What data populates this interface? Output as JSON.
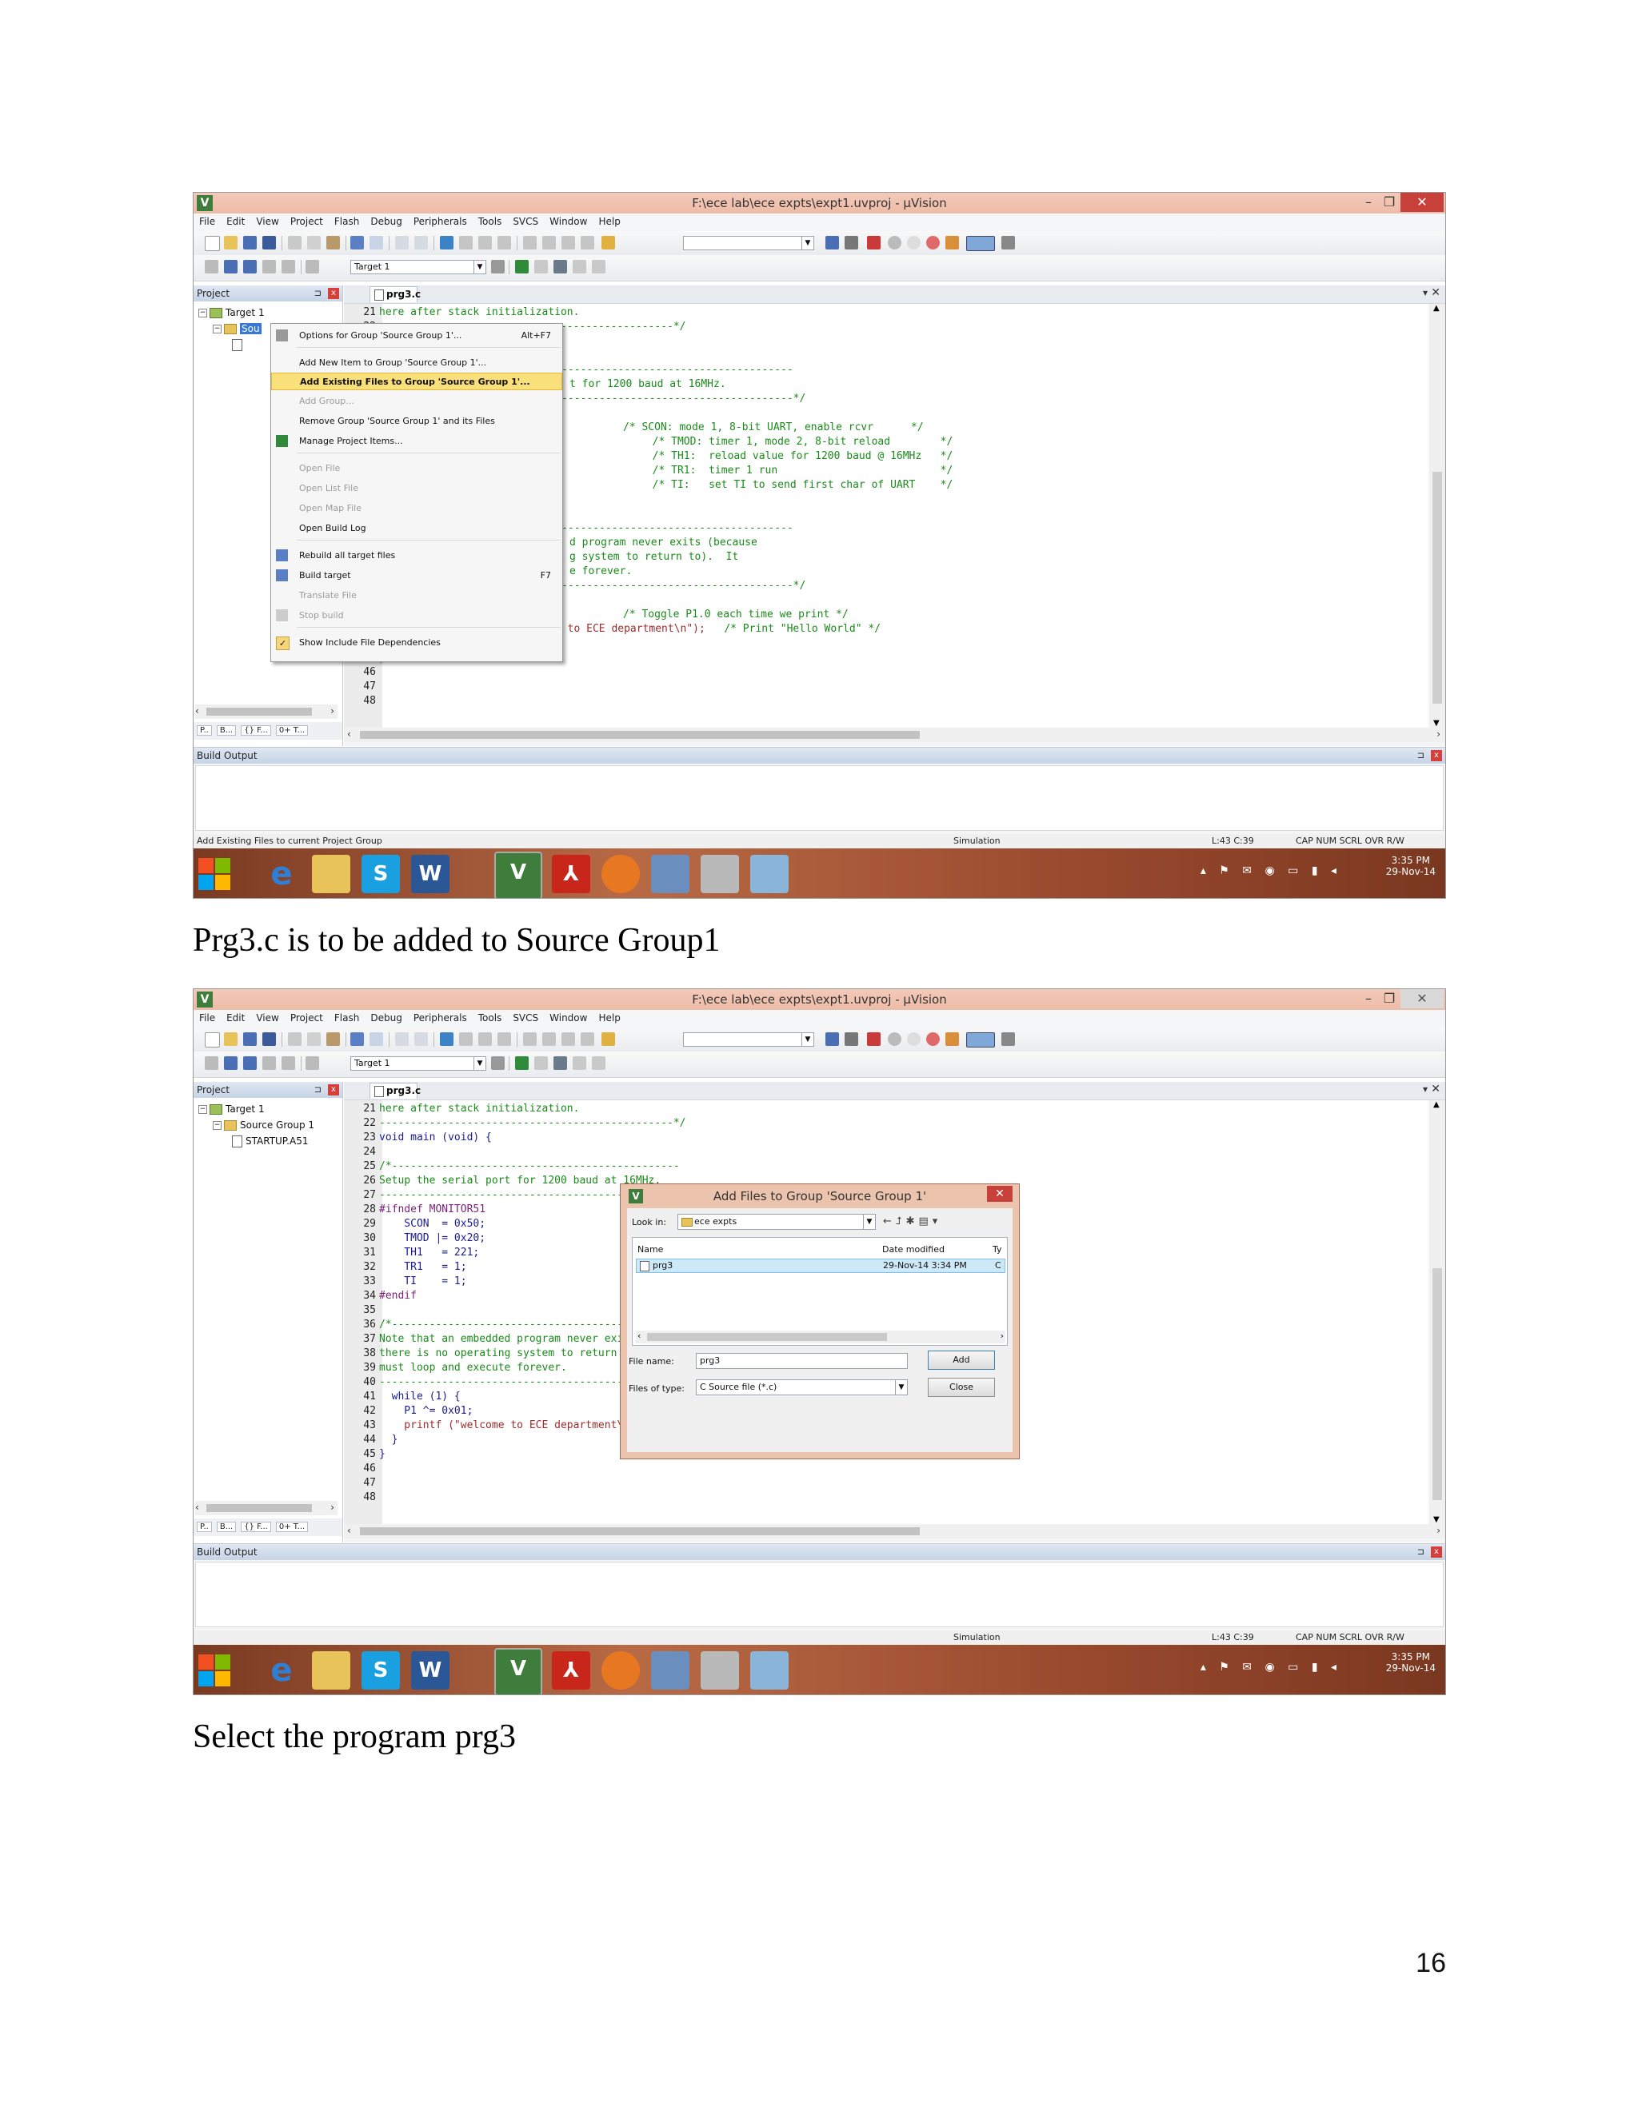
{
  "app": {
    "title": "F:\\ece lab\\ece expts\\expt1.uvproj - µVision",
    "logo": "V",
    "minimize": "–",
    "maximize": "❐",
    "close": "✕"
  },
  "menu": [
    "File",
    "Edit",
    "View",
    "Project",
    "Flash",
    "Debug",
    "Peripherals",
    "Tools",
    "SVCS",
    "Window",
    "Help"
  ],
  "toolbar": {
    "target": "Target 1"
  },
  "project_pane": {
    "title": "Project",
    "pin": "⊐",
    "close": "x",
    "target": "Target 1",
    "group_short": "Sou",
    "group": "Source Group 1",
    "file": "STARTUP.A51",
    "bottom_tabs": [
      "P..",
      "B...",
      "{} F...",
      "0+ T..."
    ]
  },
  "editor": {
    "tab": "prg3.c",
    "dropdown": "▾",
    "close": "✕"
  },
  "code_lines_full": [
    {
      "n": "21",
      "t": "here after stack initialization."
    },
    {
      "n": "22",
      "t": "-----------------------------------------------*/"
    },
    {
      "n": "23",
      "t": "void main (void) {"
    },
    {
      "n": "24",
      "t": ""
    },
    {
      "n": "25",
      "t": "/*----------------------------------------------"
    },
    {
      "n": "26",
      "t": "Setup the serial port for 1200 baud at 16MHz."
    },
    {
      "n": "27",
      "t": "------------------------------------------------*/"
    },
    {
      "n": "28",
      "t": "#ifndef MONITOR51"
    },
    {
      "n": "29",
      "t": "    SCON  = 0x50;"
    },
    {
      "n": "30",
      "t": "    TMOD |= 0x20;"
    },
    {
      "n": "31",
      "t": "    TH1   = 221;"
    },
    {
      "n": "32",
      "t": "    TR1   = 1;"
    },
    {
      "n": "33",
      "t": "    TI    = 1;"
    },
    {
      "n": "34",
      "t": "#endif"
    },
    {
      "n": "35",
      "t": ""
    },
    {
      "n": "36",
      "t": "/*----------------------------------------------"
    },
    {
      "n": "37",
      "t": "Note that an embedded program never exits (because"
    },
    {
      "n": "38",
      "t": "there is no operating system to return to).  It"
    },
    {
      "n": "39",
      "t": "must loop and execute forever."
    },
    {
      "n": "40",
      "t": "------------------------------------------------*/"
    },
    {
      "n": "41",
      "t": "  while (1) {"
    },
    {
      "n": "42",
      "t": "    P1 ^= 0x01;"
    },
    {
      "n": "43",
      "t": "    printf (\"welcome to ECE department\\n\");"
    },
    {
      "n": "44",
      "t": "  }"
    },
    {
      "n": "45",
      "t": "}"
    },
    {
      "n": "46",
      "t": ""
    },
    {
      "n": "47",
      "t": ""
    },
    {
      "n": "48",
      "t": ""
    }
  ],
  "code_comments": [
    "/* SCON: mode 1, 8-bit UART, enable rcvr      */",
    "  /* TMOD: timer 1, mode 2, 8-bit reload        */",
    "  /* TH1:  reload value for 1200 baud @ 16MHz   */",
    "  /* TR1:  timer 1 run                          */",
    "  /* TI:   set TI to send first char of UART    */",
    "/* Toggle P1.0 each time we print */",
    "/* Print \"Hello World\" */"
  ],
  "context_menu": {
    "items": [
      {
        "label": "Options for Group 'Source Group 1'...",
        "shortcut": "Alt+F7"
      },
      {
        "label": "Add New  Item to Group 'Source Group 1'..."
      },
      {
        "label": "Add Existing Files to Group 'Source Group 1'..."
      },
      {
        "label": "Add Group..."
      },
      {
        "label": "Remove Group 'Source Group 1' and its Files"
      },
      {
        "label": "Manage Project Items..."
      },
      {
        "label": "Open File"
      },
      {
        "label": "Open List File"
      },
      {
        "label": "Open Map File"
      },
      {
        "label": "Open Build Log"
      },
      {
        "label": "Rebuild all target files"
      },
      {
        "label": "Build target",
        "shortcut": "F7"
      },
      {
        "label": "Translate File"
      },
      {
        "label": "Stop build"
      },
      {
        "label": "Show Include File Dependencies"
      }
    ]
  },
  "build_output": {
    "title": "Build Output"
  },
  "status": {
    "hint1": "Add Existing Files to current Project Group",
    "hint2": "",
    "mode": "Simulation",
    "pos": "L:43 C:39",
    "keys": "CAP  NUM  SCRL  OVR  R/W"
  },
  "taskbar": {
    "time": "3:35 PM",
    "date": "29-Nov-14"
  },
  "dialog": {
    "title": "Add Files to Group 'Source Group 1'",
    "lookin_label": "Look in:",
    "lookin_value": "ece expts",
    "col_name": "Name",
    "col_date": "Date modified",
    "col_type": "Ty",
    "file_name": "prg3",
    "file_date": "29-Nov-14 3:34 PM",
    "file_type": "C",
    "filename_label": "File name:",
    "filename_value": "prg3",
    "filetype_label": "Files of type:",
    "filetype_value": "C Source file (*.c)",
    "add": "Add",
    "close": "Close"
  },
  "captions": {
    "one": "Prg3.c is to be added to Source Group1",
    "two": "Select the program prg3"
  },
  "page_number": "16",
  "colors": {
    "title_bar": "#eebca7",
    "highlight": "#f9e07a",
    "taskbar": "#9a4a2e",
    "code_comment": "#1a8a1a"
  }
}
